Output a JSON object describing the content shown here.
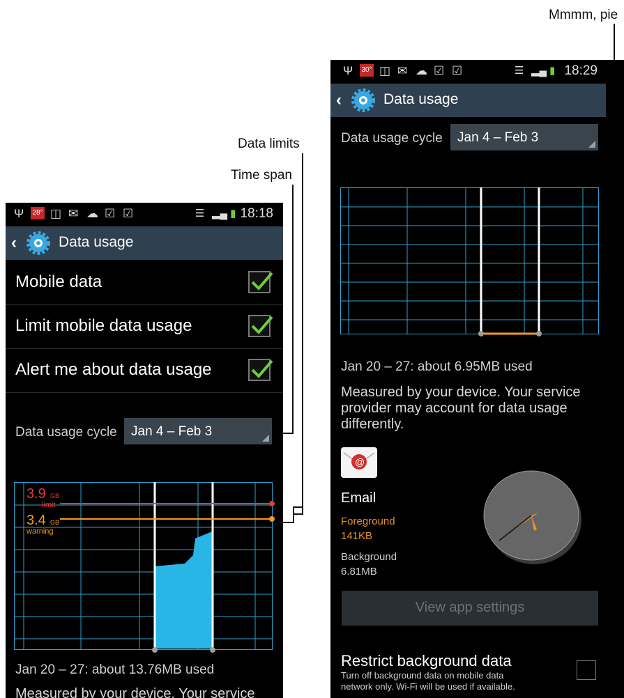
{
  "callouts": {
    "pie": "Mmmm, pie",
    "data_limits": "Data limits",
    "time_span": "Time span"
  },
  "left_phone": {
    "status": {
      "temp_badge": "28°",
      "time": "18:18"
    },
    "action_bar": {
      "title": "Data usage"
    },
    "settings": [
      {
        "label": "Mobile data",
        "checked": true
      },
      {
        "label": "Limit mobile data usage",
        "checked": true
      },
      {
        "label": "Alert me about data usage",
        "checked": true
      }
    ],
    "cycle": {
      "label": "Data usage cycle",
      "value": "Jan 4 – Feb 3"
    },
    "chart": {
      "limit_value": "3.9",
      "limit_unit": "GB",
      "limit_label": "limit",
      "warning_value": "3.4",
      "warning_unit": "GB",
      "warning_label": "warning"
    },
    "usage_text": "Jan 20 – 27: about 13.76MB used",
    "measure_text": "Measured by your device. Your service"
  },
  "right_phone": {
    "status": {
      "temp_badge": "30°",
      "time": "18:29"
    },
    "action_bar": {
      "title": "Data usage"
    },
    "cycle": {
      "label": "Data usage cycle",
      "value": "Jan 4 – Feb 3"
    },
    "usage_text": "Jan 20 – 27: about 6.95MB used",
    "measure_lines": [
      "Measured by your device. Your service",
      "provider may account for data usage",
      "differently."
    ],
    "app": {
      "name": "Email",
      "foreground_label": "Foreground",
      "foreground_value": "141KB",
      "background_label": "Background",
      "background_value": "6.81MB"
    },
    "view_button": "View app settings",
    "restrict": {
      "title": "Restrict background data",
      "sub_line1": "Turn off background data on mobile data",
      "sub_line2": "network only. Wi-Fi will be used if available."
    }
  },
  "colors": {
    "action_bar": "#2f4050",
    "check_green": "#6ccf3c",
    "grid_blue": "#2aa4d0",
    "fill_blue": "#29b6e6",
    "limit_red": "#e53935",
    "warning_orange": "#f39a1e"
  }
}
